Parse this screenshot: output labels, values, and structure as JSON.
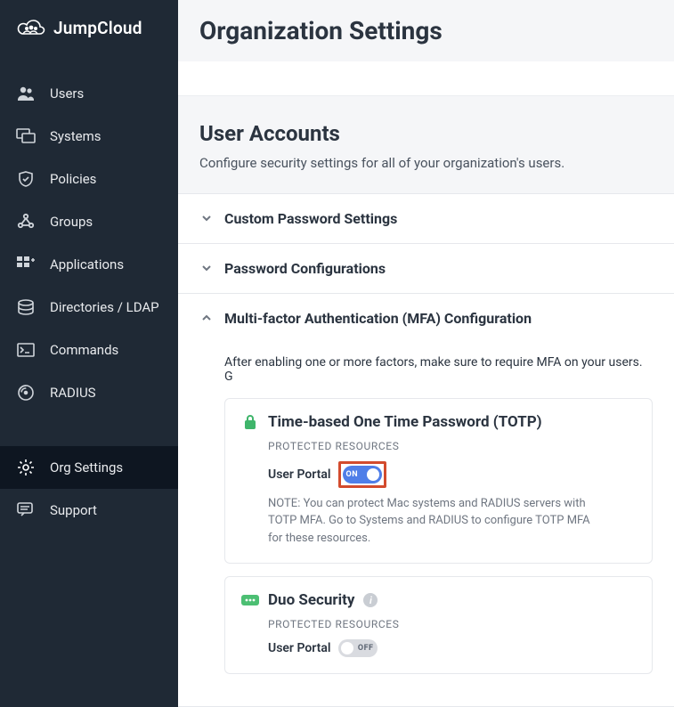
{
  "brand": {
    "name": "JumpCloud"
  },
  "sidebar": {
    "items": [
      {
        "label": "Users",
        "icon": "users-icon"
      },
      {
        "label": "Systems",
        "icon": "systems-icon"
      },
      {
        "label": "Policies",
        "icon": "policies-icon"
      },
      {
        "label": "Groups",
        "icon": "groups-icon"
      },
      {
        "label": "Applications",
        "icon": "applications-icon"
      },
      {
        "label": "Directories / LDAP",
        "icon": "directories-icon"
      },
      {
        "label": "Commands",
        "icon": "commands-icon"
      },
      {
        "label": "RADIUS",
        "icon": "radius-icon"
      }
    ],
    "secondary": [
      {
        "label": "Org Settings",
        "icon": "settings-icon",
        "active": true
      },
      {
        "label": "Support",
        "icon": "support-icon"
      }
    ]
  },
  "page": {
    "title": "Organization Settings"
  },
  "userAccounts": {
    "title": "User Accounts",
    "subtitle": "Configure security settings for all of your organization's users."
  },
  "accordion": {
    "customPassword": {
      "label": "Custom Password Settings"
    },
    "passwordConfig": {
      "label": "Password Configurations"
    },
    "mfa": {
      "label": "Multi-factor Authentication (MFA) Configuration",
      "helper": "After enabling one or more factors, make sure to require MFA on your users. G",
      "cards": {
        "totp": {
          "title": "Time-based One Time Password (TOTP)",
          "resourcesLabel": "PROTECTED RESOURCES",
          "userPortalLabel": "User Portal",
          "toggleState": "ON",
          "note": "NOTE: You can protect Mac systems and RADIUS servers with TOTP MFA. Go to Systems and RADIUS to configure TOTP MFA for these resources."
        },
        "duo": {
          "title": "Duo Security",
          "resourcesLabel": "PROTECTED RESOURCES",
          "userPortalLabel": "User Portal",
          "toggleState": "OFF"
        }
      }
    }
  }
}
